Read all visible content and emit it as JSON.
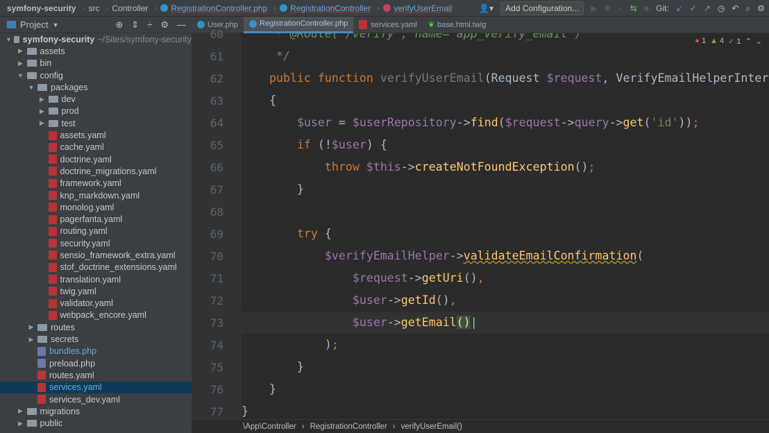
{
  "breadcrumb": [
    "symfony-security",
    "src",
    "Controller",
    "RegistrationController.php",
    "RegistrationController",
    "verifyUserEmail"
  ],
  "toolbar": {
    "add_config": "Add Configuration...",
    "git_label": "Git:"
  },
  "project_header": "Project",
  "tabs": [
    "User.php",
    "RegistrationController.php",
    "services.yaml",
    "base.html.twig"
  ],
  "active_tab": 1,
  "tree": [
    {
      "d": 0,
      "t": "root",
      "l": "symfony-security",
      "s": "~/Sites/symfony-security",
      "o": true
    },
    {
      "d": 1,
      "t": "folder",
      "l": "assets"
    },
    {
      "d": 1,
      "t": "folder",
      "l": "bin"
    },
    {
      "d": 1,
      "t": "folder",
      "l": "config",
      "o": true
    },
    {
      "d": 2,
      "t": "folder",
      "l": "packages",
      "o": true
    },
    {
      "d": 3,
      "t": "folder",
      "l": "dev"
    },
    {
      "d": 3,
      "t": "folder",
      "l": "prod"
    },
    {
      "d": 3,
      "t": "folder",
      "l": "test"
    },
    {
      "d": 3,
      "t": "yml",
      "l": "assets.yaml"
    },
    {
      "d": 3,
      "t": "yml",
      "l": "cache.yaml"
    },
    {
      "d": 3,
      "t": "yml",
      "l": "doctrine.yaml"
    },
    {
      "d": 3,
      "t": "yml",
      "l": "doctrine_migrations.yaml"
    },
    {
      "d": 3,
      "t": "yml",
      "l": "framework.yaml"
    },
    {
      "d": 3,
      "t": "yml",
      "l": "knp_markdown.yaml"
    },
    {
      "d": 3,
      "t": "yml",
      "l": "monolog.yaml"
    },
    {
      "d": 3,
      "t": "yml",
      "l": "pagerfanta.yaml"
    },
    {
      "d": 3,
      "t": "yml",
      "l": "routing.yaml"
    },
    {
      "d": 3,
      "t": "yml",
      "l": "security.yaml"
    },
    {
      "d": 3,
      "t": "yml",
      "l": "sensio_framework_extra.yaml"
    },
    {
      "d": 3,
      "t": "yml",
      "l": "stof_doctrine_extensions.yaml"
    },
    {
      "d": 3,
      "t": "yml",
      "l": "translation.yaml"
    },
    {
      "d": 3,
      "t": "yml",
      "l": "twig.yaml"
    },
    {
      "d": 3,
      "t": "yml",
      "l": "validator.yaml"
    },
    {
      "d": 3,
      "t": "yml",
      "l": "webpack_encore.yaml"
    },
    {
      "d": 2,
      "t": "folder",
      "l": "routes"
    },
    {
      "d": 2,
      "t": "folder",
      "l": "secrets"
    },
    {
      "d": 2,
      "t": "php",
      "l": "bundles.php",
      "blue": true
    },
    {
      "d": 2,
      "t": "php",
      "l": "preload.php"
    },
    {
      "d": 2,
      "t": "yml",
      "l": "routes.yaml"
    },
    {
      "d": 2,
      "t": "yml",
      "l": "services.yaml",
      "sel": true
    },
    {
      "d": 2,
      "t": "yml",
      "l": "services_dev.yaml"
    },
    {
      "d": 1,
      "t": "folder",
      "l": "migrations"
    },
    {
      "d": 1,
      "t": "folder",
      "l": "public"
    }
  ],
  "code": [
    {
      "n": "60",
      "h": "     <span class='cm'>* @Route(\"/verify\", name=\"app_verify_email\")</span>"
    },
    {
      "n": "61",
      "h": "     <span class='cm'>*/</span>"
    },
    {
      "n": "62",
      "h": "    <span class='kw'>public function</span> <span class='dim'>verifyUserEmail</span>(Request <span class='var'>$request</span>, VerifyEmailHelperInterface"
    },
    {
      "n": "63",
      "h": "    {"
    },
    {
      "n": "64",
      "h": "        <span class='var'>$user</span> = <span class='var'>$userRepository</span>-><span class='fn'>find</span>(<span class='var'>$request</span>-><span class='var'>query</span>-><span class='fn'>get</span>(<span class='str'>'id'</span>))<span class='kw'>;</span>"
    },
    {
      "n": "65",
      "h": "        <span class='kw'>if</span> (!<span class='var'>$user</span>) {"
    },
    {
      "n": "66",
      "h": "            <span class='kw'>throw</span> <span class='var'>$this</span>-><span class='fn'>createNotFoundException</span>()<span class='kw'>;</span>"
    },
    {
      "n": "67",
      "h": "        }"
    },
    {
      "n": "68",
      "h": ""
    },
    {
      "n": "69",
      "h": "        <span class='kw'>try</span> {"
    },
    {
      "n": "70",
      "h": "            <span class='var'>$verifyEmailHelper</span>-><span class='fn' style='text-decoration:underline wavy #a08a2b'>validateEmailConfirmation</span>("
    },
    {
      "n": "71",
      "h": "                <span class='var'>$request</span>-><span class='fn'>getUri</span>()<span class='kw'>,</span>"
    },
    {
      "n": "72",
      "h": "                <span class='var'>$user</span>-><span class='fn'>getId</span>()<span class='kw'>,</span>"
    },
    {
      "n": "73",
      "h": "                <span class='var'>$user</span>-><span class='fn'>getEmail</span><span style='background:#3b514d;color:#ffef28'>()</span>|"
    },
    {
      "n": "74",
      "h": "            )<span class='kw'>;</span>"
    },
    {
      "n": "75",
      "h": "        }"
    },
    {
      "n": "76",
      "h": "    }"
    },
    {
      "n": "77",
      "h": "}"
    }
  ],
  "inspections": {
    "errors": "1",
    "warnings": "4",
    "typos": "1"
  },
  "status_crumbs": [
    "\\App\\Controller",
    "RegistrationController",
    "verifyUserEmail()"
  ]
}
